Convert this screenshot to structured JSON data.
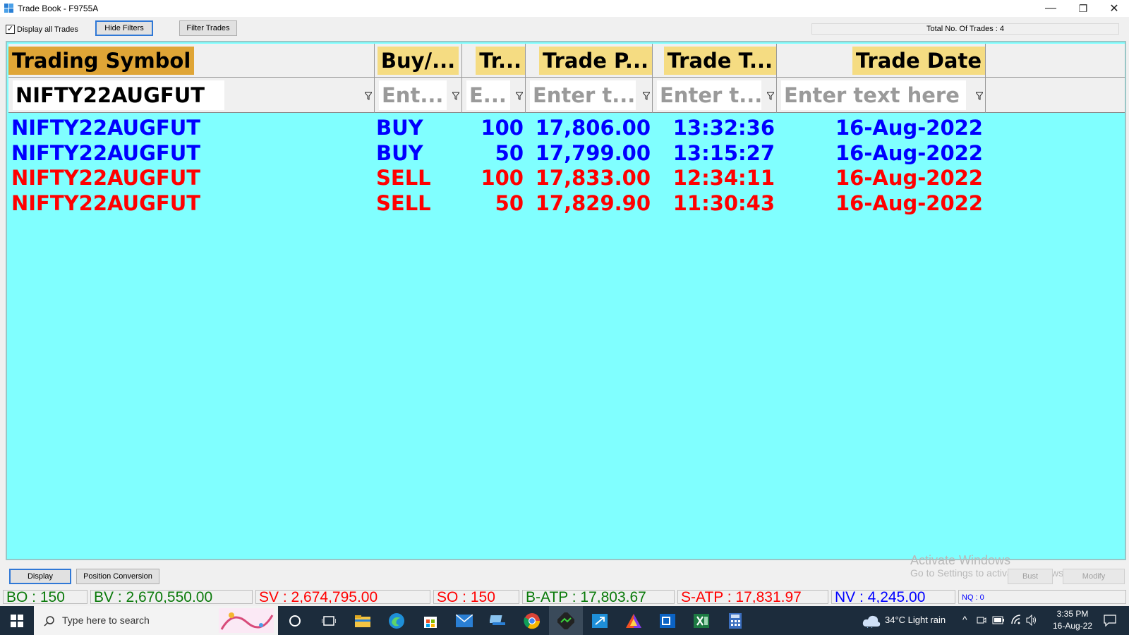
{
  "window": {
    "title": "Trade Book - F9755A",
    "minimize": "—",
    "restore": "❐",
    "close": "✕"
  },
  "toolbar": {
    "display_all_label": "Display all Trades",
    "display_all_checked": true,
    "check_mark": "✓",
    "hide_filters": "Hide Filters",
    "filter_trades": "Filter Trades",
    "total_trades": "Total No. Of Trades : 4"
  },
  "grid": {
    "columns": [
      "Trading Symbol",
      "Buy/...",
      "Tr...",
      "Trade P...",
      "Trade T...",
      "Trade Date"
    ],
    "filters": [
      "NIFTY22AUGFUT",
      "Ent...",
      "E...",
      "Enter t...",
      "Enter t...",
      "Enter text here"
    ],
    "rows": [
      {
        "symbol": "NIFTY22AUGFUT",
        "side": "BUY",
        "qty": "100",
        "price": "17,806.00",
        "time": "13:32:36",
        "date": "16-Aug-2022",
        "color": "#0000ff"
      },
      {
        "symbol": "NIFTY22AUGFUT",
        "side": "BUY",
        "qty": "50",
        "price": "17,799.00",
        "time": "13:15:27",
        "date": "16-Aug-2022",
        "color": "#0000ff"
      },
      {
        "symbol": "NIFTY22AUGFUT",
        "side": "SELL",
        "qty": "100",
        "price": "17,833.00",
        "time": "12:34:11",
        "date": "16-Aug-2022",
        "color": "#ff0000"
      },
      {
        "symbol": "NIFTY22AUGFUT",
        "side": "SELL",
        "qty": "50",
        "price": "17,829.90",
        "time": "11:30:43",
        "date": "16-Aug-2022",
        "color": "#ff0000"
      }
    ]
  },
  "watermark": {
    "line1": "Activate Windows",
    "line2": "Go to Settings to activate Windows."
  },
  "bottom": {
    "display": "Display",
    "position_conversion": "Position Conversion",
    "bust": "Bust",
    "modify": "Modify"
  },
  "status": {
    "bo": "BO : 150",
    "bv": "BV : 2,670,550.00",
    "sv": "SV : 2,674,795.00",
    "so": "SO : 150",
    "batp": "B-ATP : 17,803.67",
    "satp": "S-ATP : 17,831.97",
    "nv": "NV : 4,245.00",
    "nq": "NQ : 0"
  },
  "taskbar": {
    "search_placeholder": "Type here to search",
    "weather": "34°C  Light rain",
    "time": "3:35 PM",
    "date": "16-Aug-22",
    "icons": [
      "windows-start-icon",
      "search-icon",
      "cortana-icon",
      "task-view-icon",
      "file-explorer-icon",
      "edge-icon",
      "store-icon",
      "mail-icon",
      "app-icon",
      "chrome-icon",
      "trading-app-icon",
      "remote-desktop-icon",
      "prism-icon",
      "outlook-icon",
      "excel-icon",
      "calculator-icon"
    ]
  },
  "colors": {
    "grid_bg": "#80ffff",
    "buy": "#0000ff",
    "sell": "#ff0000",
    "sorted_header": "#dfa536",
    "header": "#f5dc82"
  }
}
